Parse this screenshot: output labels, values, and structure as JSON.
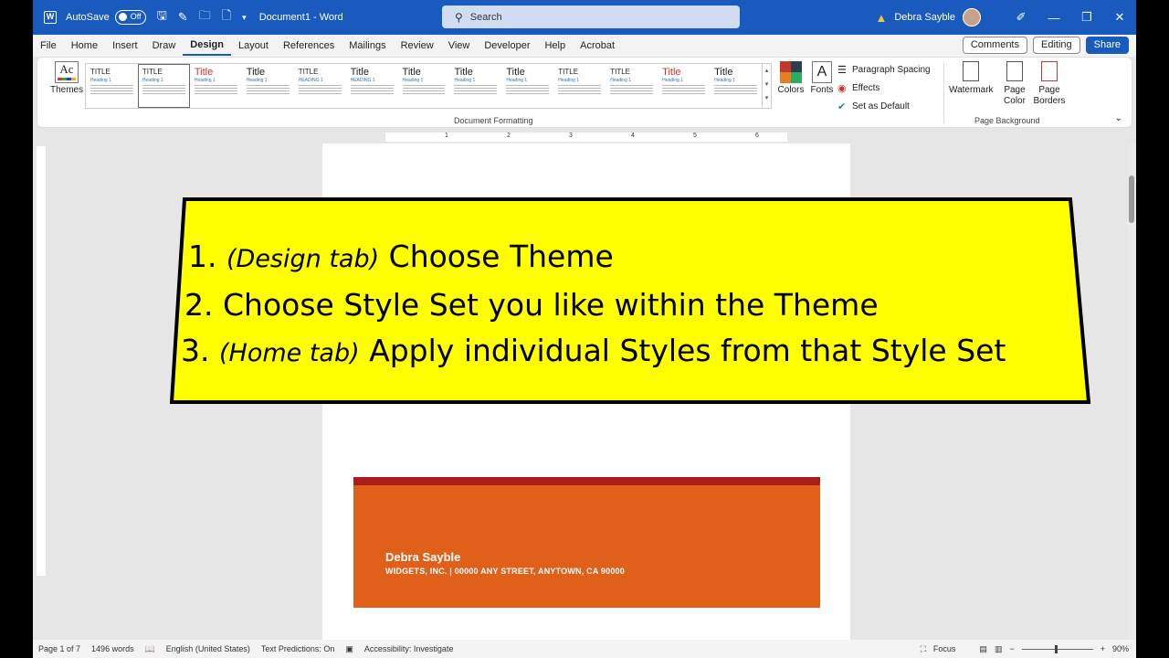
{
  "titlebar": {
    "autosave_label": "AutoSave",
    "autosave_state": "Off",
    "doc_title": "Document1  -  Word",
    "search_placeholder": "Search",
    "user_name": "Debra Sayble",
    "minimize": "—",
    "restore": "❐",
    "close": "✕"
  },
  "tabs": [
    "File",
    "Home",
    "Insert",
    "Draw",
    "Design",
    "Layout",
    "References",
    "Mailings",
    "Review",
    "View",
    "Developer",
    "Help",
    "Acrobat"
  ],
  "active_tab": "Design",
  "tab_actions": {
    "comments": "Comments",
    "editing": "Editing",
    "share": "Share"
  },
  "ribbon": {
    "themes_label": "Themes",
    "themes_glyph": "Ac",
    "styles": [
      {
        "title": "TITLE",
        "head": "Heading 1"
      },
      {
        "title": "TITLE",
        "head": "Heading 1"
      },
      {
        "title": "Title",
        "head": "Heading 1"
      },
      {
        "title": "Title",
        "head": "Heading 1"
      },
      {
        "title": "TITLE",
        "head": "HEADING 1"
      },
      {
        "title": "Title",
        "head": "HEADING 1"
      },
      {
        "title": "Title",
        "head": "Heading 1"
      },
      {
        "title": "Title",
        "head": "Heading 1"
      },
      {
        "title": "Title",
        "head": "Heading 1"
      },
      {
        "title": "TITLE",
        "head": "Heading 1"
      },
      {
        "title": "TITLE",
        "head": "Heading 1"
      },
      {
        "title": "Title",
        "head": "Heading 1"
      },
      {
        "title": "Title",
        "head": "Heading 1"
      }
    ],
    "document_formatting_label": "Document Formatting",
    "colors_label": "Colors",
    "fonts_label": "Fonts",
    "fonts_glyph": "A",
    "paragraph_spacing_label": "Paragraph Spacing",
    "effects_label": "Effects",
    "set_default_label": "Set as Default",
    "watermark_label": "Watermark",
    "page_color_label": "Page Color",
    "page_borders_label": "Page Borders",
    "page_background_label": "Page Background"
  },
  "ruler_numbers": [
    "1",
    "2",
    "3",
    "4",
    "5",
    "6"
  ],
  "callout": {
    "step1_num": "1.",
    "step1_context": "(Design tab)",
    "step1_text": "Choose Theme",
    "step2_num": "2.",
    "step2_text": "Choose Style Set you like within the Theme",
    "step3_num": "3.",
    "step3_context": "(Home tab)",
    "step3_text": "Apply individual Styles from that Style Set"
  },
  "document": {
    "name": "Debra Sayble",
    "address": "WIDGETS, INC.  |  00000 ANY STREET, ANYTOWN, CA 90000"
  },
  "statusbar": {
    "page": "Page 1 of 7",
    "words": "1496 words",
    "language": "English (United States)",
    "predictions": "Text Predictions: On",
    "accessibility": "Accessibility: Investigate",
    "focus": "Focus",
    "zoom": "90%"
  },
  "colors": {
    "accent": "#185abd",
    "callout_bg": "#ffff00",
    "card": "#e0601a",
    "card_band": "#a91c1c"
  }
}
